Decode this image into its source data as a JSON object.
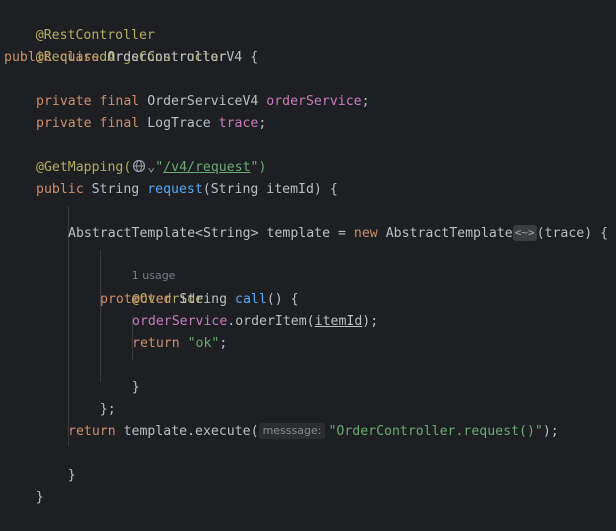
{
  "code": {
    "l1_annotation": "@RestController",
    "l2_annotation": "@RequiredArgsConstructor",
    "l3_kw_public": "public",
    "l3_kw_class": "class",
    "l3_class_name": "OrderControllerV4",
    "brace_open": "{",
    "brace_close": "}",
    "kw_private": "private",
    "kw_final": "final",
    "l5_type": "OrderServiceV4",
    "l5_field": "orderService",
    "semicolon": ";",
    "l6_type": "LogTrace",
    "l6_field": "trace",
    "l8_annotation": "@GetMapping(",
    "l8_icon_glyph": "⌄",
    "l8_quote": "\"",
    "l8_url": "/v4/request",
    "l8_close": "\")",
    "l9_kw_public": "public",
    "l9_type": "String",
    "l9_method": "request",
    "l9_params": "(String itemId)",
    "l11_template_type": "AbstractTemplate<String>",
    "l11_var": "template",
    "l11_eq": "=",
    "l11_kw_new": "new",
    "l11_ctor": "AbstractTemplate",
    "l11_diamond": "<~>",
    "l11_args": "(trace)",
    "l12_usage": "1 usage",
    "l13_annotation": "@Override",
    "l14_kw_protected": "protected",
    "l14_type": "String",
    "l14_method": "call",
    "l14_parens": "()",
    "l15_field": "orderService",
    "l15_call": ".orderItem(",
    "l15_arg": "itemId",
    "l15_end": ");",
    "l16_kw_return": "return",
    "l16_str": "\"ok\"",
    "l18_close": "};",
    "l20_kw_return": "return",
    "l20_call": "template.execute(",
    "l20_hint": "messsage:",
    "l20_str": "\"OrderController.request()\"",
    "l20_end": ");"
  },
  "icons": {
    "mapping_icon": "globe-icon",
    "dropdown_icon": "chevron-down-icon"
  },
  "colors": {
    "background": "#1e1f22",
    "keyword": "#cf8e6d",
    "annotation": "#b3ae60",
    "field": "#c77dbb",
    "method": "#56a8f5",
    "string": "#6aab73"
  }
}
